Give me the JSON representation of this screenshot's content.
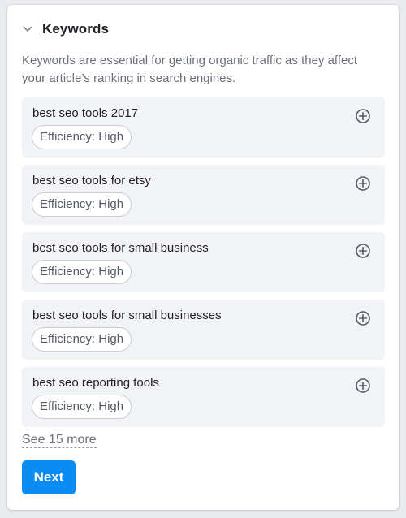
{
  "section": {
    "title": "Keywords",
    "description": "Keywords are essential for getting organic traffic as they affect your article’s ranking in search engines."
  },
  "keywords": [
    {
      "text": "best seo tools 2017",
      "badge": "Efficiency: High"
    },
    {
      "text": "best seo tools for etsy",
      "badge": "Efficiency: High"
    },
    {
      "text": "best seo tools for small business",
      "badge": "Efficiency: High"
    },
    {
      "text": "best seo tools for small businesses",
      "badge": "Efficiency: High"
    },
    {
      "text": "best seo reporting tools",
      "badge": "Efficiency: High"
    }
  ],
  "see_more_label": "See 15 more",
  "next_label": "Next",
  "icons": {
    "collapse": "chevron-down-icon",
    "add": "plus-circle-icon"
  },
  "colors": {
    "accent": "#0a8cf5",
    "card_bg": "#f2f3f6",
    "text_primary": "#1f1f24",
    "text_muted": "#6b6f7a"
  }
}
